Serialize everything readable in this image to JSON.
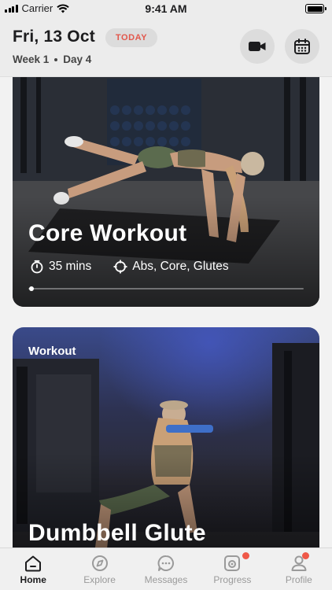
{
  "status": {
    "carrier": "Carrier",
    "time": "9:41 AM"
  },
  "header": {
    "date": "Fri, 13 Oct",
    "today_badge": "TODAY",
    "week": "Week 1",
    "day": "Day 4"
  },
  "cards": [
    {
      "title": "Core Workout",
      "duration": "35 mins",
      "focus": "Abs, Core, Glutes",
      "progress": 0.01
    },
    {
      "tag": "Workout",
      "title": "Dumbbell Glute"
    }
  ],
  "tabbar": {
    "items": [
      {
        "label": "Home",
        "active": true
      },
      {
        "label": "Explore"
      },
      {
        "label": "Messages"
      },
      {
        "label": "Progress",
        "badge": true
      },
      {
        "label": "Profile",
        "badge": true
      }
    ]
  },
  "colors": {
    "accent": "#e2574c",
    "badge": "#ef5848"
  }
}
